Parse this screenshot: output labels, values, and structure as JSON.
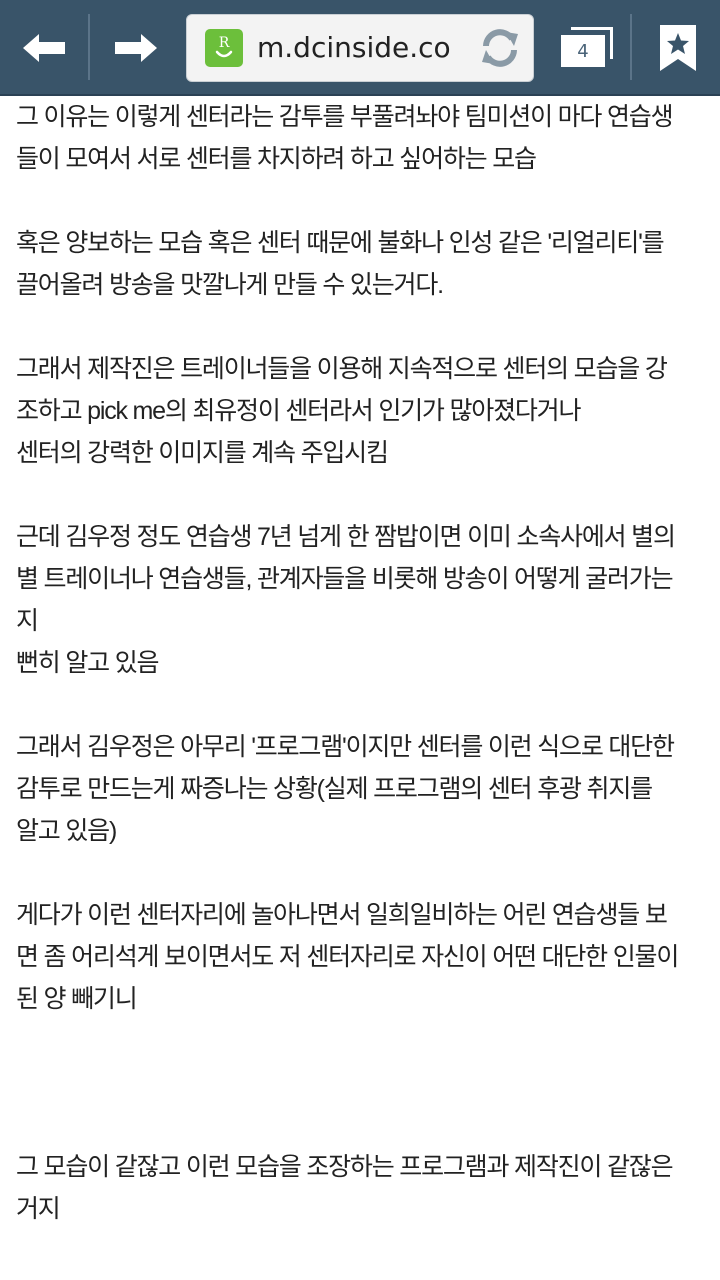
{
  "toolbar": {
    "url": "m.dcinside.co",
    "tab_count": "4",
    "site_icon_letter": "R",
    "colors": {
      "toolbar_bg": "#395469",
      "site_icon_bg": "#6cbf3b",
      "reload_icon": "#8a9aa6"
    },
    "icons": [
      "back-arrow-icon",
      "forward-arrow-icon",
      "site-favicon",
      "reload-icon",
      "tabs-icon",
      "bookmark-star-icon"
    ]
  },
  "article": {
    "lines": [
      "그 이유는 이렇게 센터라는 감투를 부풀려놔야 팀미션이 마다 연습생",
      "들이 모여서 서로 센터를 차지하려 하고 싶어하는 모습",
      "",
      "혹은 양보하는 모습 혹은 센터 때문에 불화나 인성 같은 '리얼리티'를",
      "끌어올려 방송을 맛깔나게 만들 수 있는거다.",
      "",
      "그래서 제작진은 트레이너들을 이용해 지속적으로 센터의 모습을 강",
      "조하고 pick me의 최유정이 센터라서 인기가 많아졌다거나",
      "센터의 강력한 이미지를 계속 주입시킴",
      "",
      "근데 김우정 정도 연습생 7년 넘게 한 짬밥이면 이미 소속사에서 별의",
      "별 트레이너나 연습생들, 관계자들을 비롯해 방송이 어떻게 굴러가는",
      "지",
      "뻔히 알고 있음",
      "",
      "그래서 김우정은 아무리 '프로그램'이지만 센터를 이런 식으로 대단한",
      "감투로 만드는게 짜증나는 상황(실제 프로그램의 센터 후광 취지를",
      "알고 있음)",
      "",
      "게다가 이런 센터자리에 놀아나면서 일희일비하는 어린 연습생들 보",
      "면 좀 어리석게 보이면서도 저 센터자리로 자신이 어떤 대단한 인물이",
      "된 양 빼기니",
      "",
      "",
      "",
      "그 모습이 같잖고 이런 모습을 조장하는 프로그램과 제작진이 같잖은",
      "거지"
    ]
  }
}
